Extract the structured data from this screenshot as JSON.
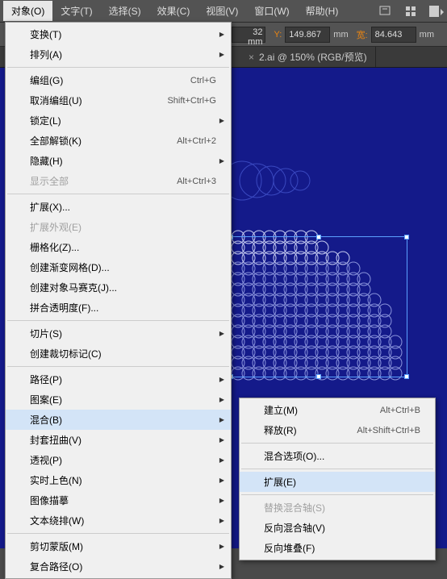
{
  "menubar": {
    "items": [
      {
        "label": "对象(O)"
      },
      {
        "label": "文字(T)"
      },
      {
        "label": "选择(S)"
      },
      {
        "label": "效果(C)"
      },
      {
        "label": "视图(V)"
      },
      {
        "label": "窗口(W)"
      },
      {
        "label": "帮助(H)"
      }
    ]
  },
  "toolbar": {
    "x_suffix": "32 mm",
    "y_label": "Y:",
    "y_value": "149.867",
    "w_label": "宽:",
    "w_value": "84.643",
    "unit": "mm"
  },
  "tabs": {
    "tab1": {
      "title": "2.ai @ 150% (RGB/预览)"
    }
  },
  "dropdown": {
    "transform": "变换(T)",
    "arrange": "排列(A)",
    "group": "编组(G)",
    "group_sc": "Ctrl+G",
    "ungroup": "取消编组(U)",
    "ungroup_sc": "Shift+Ctrl+G",
    "lock": "锁定(L)",
    "unlock_all": "全部解锁(K)",
    "unlock_all_sc": "Alt+Ctrl+2",
    "hide": "隐藏(H)",
    "show_all": "显示全部",
    "show_all_sc": "Alt+Ctrl+3",
    "expand": "扩展(X)...",
    "expand_appearance": "扩展外观(E)",
    "rasterize": "栅格化(Z)...",
    "gradient_mesh": "创建渐变网格(D)...",
    "object_mosaic": "创建对象马赛克(J)...",
    "flatten": "拼合透明度(F)...",
    "slice": "切片(S)",
    "crop_marks": "创建裁切标记(C)",
    "path": "路径(P)",
    "pattern": "图案(E)",
    "blend": "混合(B)",
    "envelope": "封套扭曲(V)",
    "perspective": "透视(P)",
    "live_paint": "实时上色(N)",
    "image_trace": "图像描摹",
    "text_wrap": "文本绕排(W)",
    "clipping_mask": "剪切蒙版(M)",
    "compound_path": "复合路径(O)"
  },
  "submenu": {
    "make": "建立(M)",
    "make_sc": "Alt+Ctrl+B",
    "release": "释放(R)",
    "release_sc": "Alt+Shift+Ctrl+B",
    "options": "混合选项(O)...",
    "expand": "扩展(E)",
    "replace_spine": "替换混合轴(S)",
    "reverse_spine": "反向混合轴(V)",
    "reverse_stack": "反向堆叠(F)"
  }
}
